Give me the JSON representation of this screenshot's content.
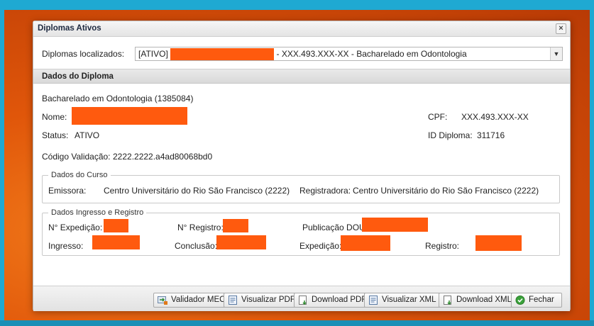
{
  "dialog": {
    "title": "Diplomas Ativos",
    "close_symbol": "×"
  },
  "selector": {
    "label": "Diplomas localizados:",
    "status_prefix": "[ATIVO]",
    "suffix": "- XXX.493.XXX-XX - Bacharelado em Odontologia"
  },
  "section": {
    "title": "Dados do Diploma"
  },
  "diploma": {
    "course_line": "Bacharelado em Odontologia (1385084)",
    "nome_label": "Nome:",
    "cpf_label": "CPF:",
    "cpf_value": "XXX.493.XXX-XX",
    "status_label": "Status:",
    "status_value": "ATIVO",
    "id_label": "ID Diploma:",
    "id_value": "311716",
    "codigo_label": "Código Validação:",
    "codigo_value": "2222.2222.a4ad80068bd0"
  },
  "curso": {
    "legend": "Dados do Curso",
    "emissora_label": "Emissora:",
    "emissora_value": "Centro Universitário do Rio São Francisco (2222)",
    "registradora_label": "Registradora:",
    "registradora_value": "Centro Universitário do Rio São Francisco (2222)"
  },
  "ingresso": {
    "legend": "Dados Ingresso e Registro",
    "expedicao_num_label": "N° Expedição:",
    "registro_num_label": "N° Registro:",
    "publicacao_label": "Publicação DOU:",
    "ingresso_label": "Ingresso:",
    "conclusao_label": "Conclusão:",
    "expedicao_label": "Expedição:",
    "registro_label": "Registro:"
  },
  "footer": {
    "buttons": [
      {
        "label": "Validador MEC",
        "icon": "validator-icon"
      },
      {
        "label": "Visualizar PDF",
        "icon": "document-view-icon"
      },
      {
        "label": "Download PDF",
        "icon": "document-download-icon"
      },
      {
        "label": "Visualizar XML",
        "icon": "document-view-icon"
      },
      {
        "label": "Download XML",
        "icon": "document-download-icon"
      },
      {
        "label": "Fechar",
        "icon": "check-circle-icon"
      }
    ]
  },
  "colors": {
    "redaction": "#ff5a0e",
    "background_orange": "#e0560a",
    "background_blue": "#1fa9d2"
  }
}
